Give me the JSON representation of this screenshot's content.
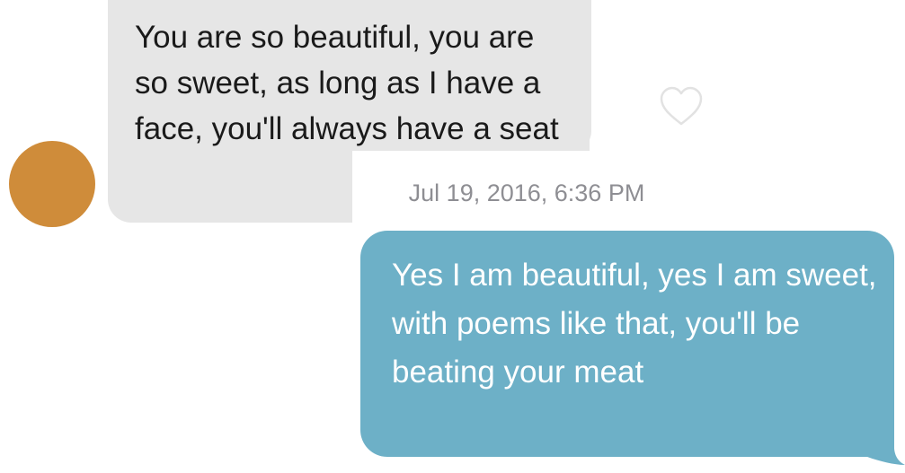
{
  "conversation": {
    "received_message": "You are so beautiful, you are so sweet, as long as I have a face, you'll always have a seat",
    "timestamp": "Jul 19, 2016, 6:36 PM",
    "sent_message": "Yes I am beautiful, yes I am sweet, with poems like that, you'll be beating your meat"
  },
  "icons": {
    "like": "heart-outline-icon"
  },
  "colors": {
    "received_bubble": "#e6e6e6",
    "sent_bubble": "#6db0c7",
    "avatar": "#cf8c3a",
    "timestamp_text": "#8e8e93"
  }
}
